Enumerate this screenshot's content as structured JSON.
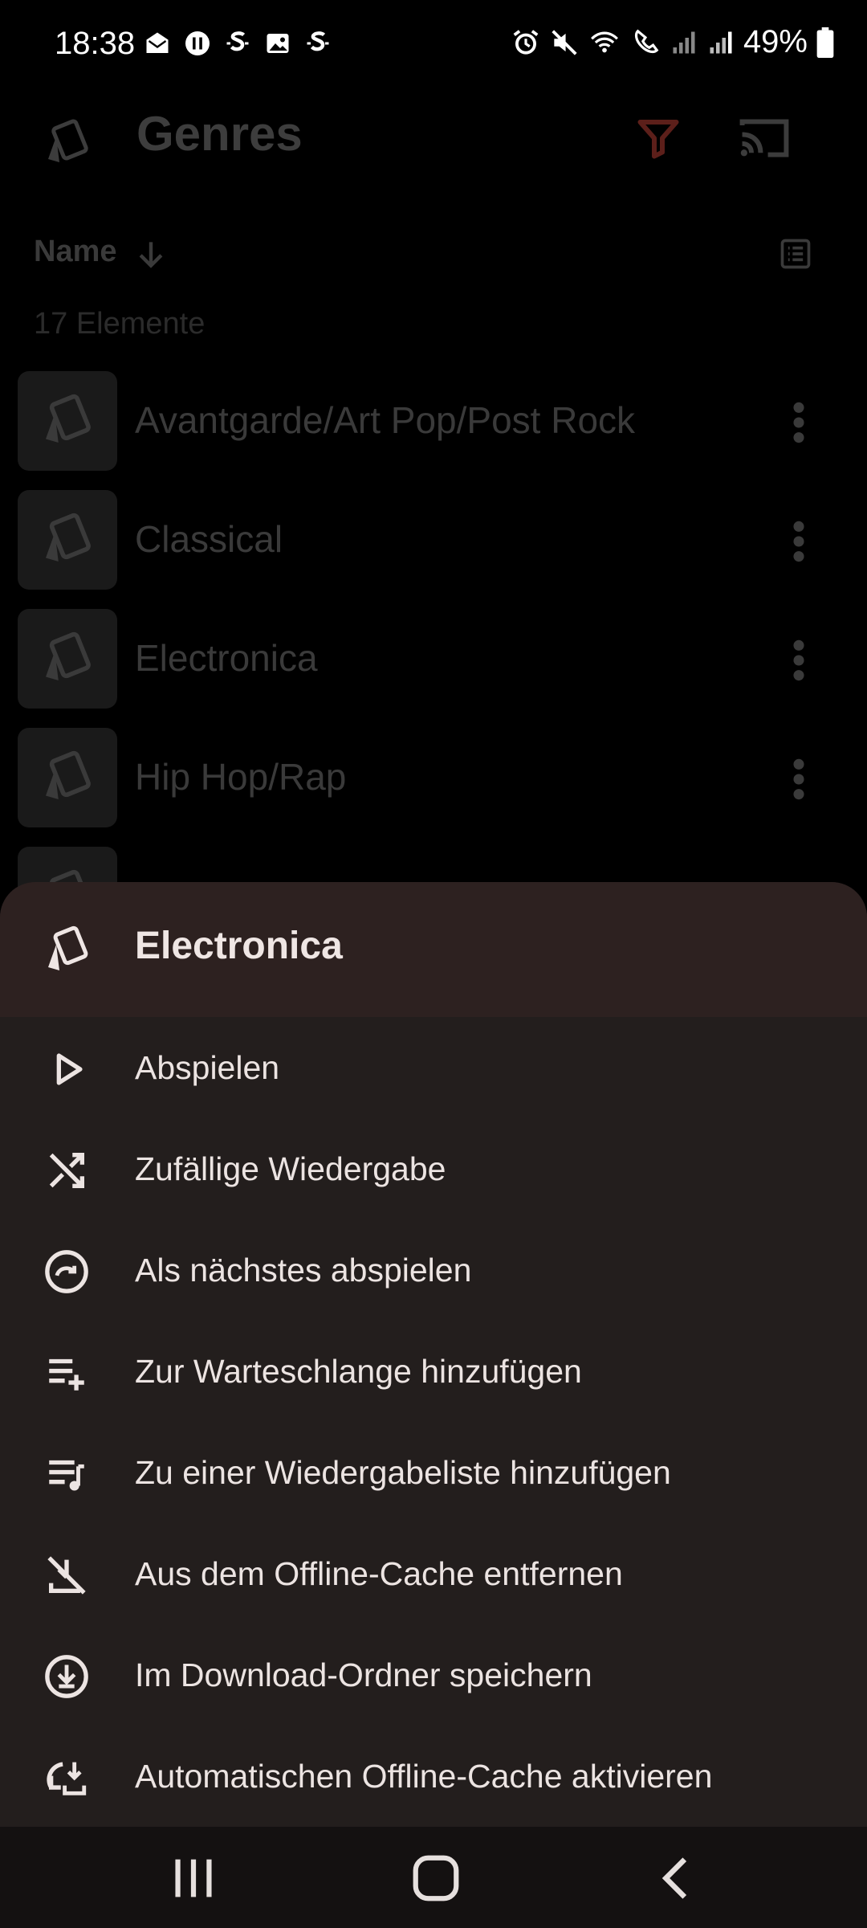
{
  "status_bar": {
    "time": "18:38",
    "battery": "49%"
  },
  "app_bar": {
    "title": "Genres"
  },
  "sort": {
    "label": "Name",
    "count": "17 Elemente"
  },
  "list": [
    {
      "label": "Avantgarde/Art Pop/Post Rock"
    },
    {
      "label": "Classical"
    },
    {
      "label": "Electronica"
    },
    {
      "label": "Hip Hop/Rap"
    }
  ],
  "sheet": {
    "title": "Electronica",
    "items": [
      {
        "label": "Abspielen",
        "icon": "play-icon"
      },
      {
        "label": "Zufällige Wiedergabe",
        "icon": "shuffle-icon"
      },
      {
        "label": "Als nächstes abspielen",
        "icon": "play-next-icon"
      },
      {
        "label": "Zur Warteschlange hinzufügen",
        "icon": "queue-add-icon"
      },
      {
        "label": "Zu einer Wiedergabeliste hinzufügen",
        "icon": "playlist-add-icon"
      },
      {
        "label": "Aus dem Offline-Cache entfernen",
        "icon": "cache-remove-icon"
      },
      {
        "label": "Im Download-Ordner speichern",
        "icon": "download-icon"
      },
      {
        "label": "Automatischen Offline-Cache aktivieren",
        "icon": "auto-cache-icon"
      }
    ]
  },
  "colors": {
    "accent": "#7a2a22",
    "sheet_bg": "#231e1d",
    "sheet_header_bg": "#2d2120"
  }
}
